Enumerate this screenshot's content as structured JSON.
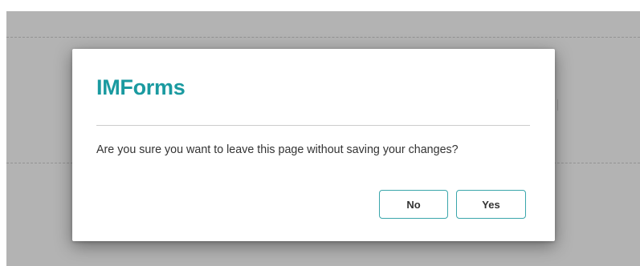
{
  "dialog": {
    "title": "IMForms",
    "message": "Are you sure you want to leave this page without saving your changes?",
    "buttons": {
      "no_label": "No",
      "yes_label": "Yes"
    }
  },
  "colors": {
    "accent": "#1A9AA0",
    "button_border": "#3AA6AB",
    "overlay": "#B3B3B3",
    "text": "#333333"
  }
}
